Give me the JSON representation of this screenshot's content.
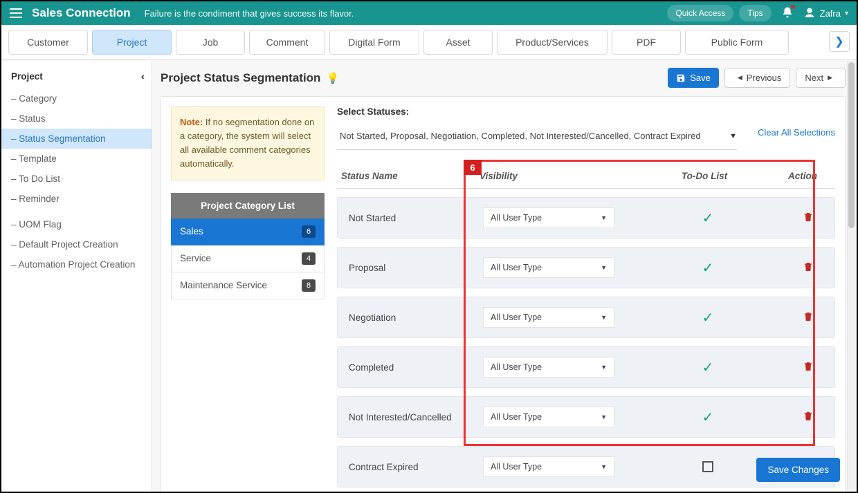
{
  "header": {
    "brand": "Sales Connection",
    "tagline": "Failure is the condiment that gives success its flavor.",
    "quick_access": "Quick Access",
    "tips": "Tips",
    "user_name": "Zafra"
  },
  "tabs": [
    "Customer",
    "Project",
    "Job",
    "Comment",
    "Digital Form",
    "Asset",
    "Product/Services",
    "PDF",
    "Public Form"
  ],
  "tabs_active_index": 1,
  "sidebar": {
    "title": "Project",
    "items": [
      "Category",
      "Status",
      "Status Segmentation",
      "Template",
      "To Do List",
      "Reminder",
      "",
      "UOM Flag",
      "Default Project Creation",
      "Automation Project Creation"
    ],
    "active_index": 2
  },
  "page": {
    "title": "Project Status Segmentation",
    "save": "Save",
    "previous": "Previous",
    "next": "Next"
  },
  "note": {
    "label": "Note:",
    "text": "If no segmentation done on a category, the system will select all available comment categories automatically."
  },
  "category_list": {
    "title": "Project Category List",
    "items": [
      {
        "name": "Sales",
        "count": "6"
      },
      {
        "name": "Service",
        "count": "4"
      },
      {
        "name": "Maintenance Service",
        "count": "8"
      }
    ],
    "active_index": 0
  },
  "select_statuses": {
    "label": "Select Statuses:",
    "value": "Not Started, Proposal, Negotiation, Completed, Not Interested/Cancelled, Contract Expired",
    "clear": "Clear All Selections"
  },
  "table": {
    "headers": {
      "name": "Status Name",
      "visibility": "Visibility",
      "todo": "To-Do List",
      "action": "Action"
    },
    "visibility_default": "All User Type",
    "rows": [
      {
        "name": "Not Started",
        "todo_checked": true
      },
      {
        "name": "Proposal",
        "todo_checked": true
      },
      {
        "name": "Negotiation",
        "todo_checked": true
      },
      {
        "name": "Completed",
        "todo_checked": true
      },
      {
        "name": "Not Interested/Cancelled",
        "todo_checked": true
      },
      {
        "name": "Contract Expired",
        "todo_checked": false
      }
    ]
  },
  "annotation": {
    "num": "6"
  },
  "bottom_save": "Save Changes"
}
